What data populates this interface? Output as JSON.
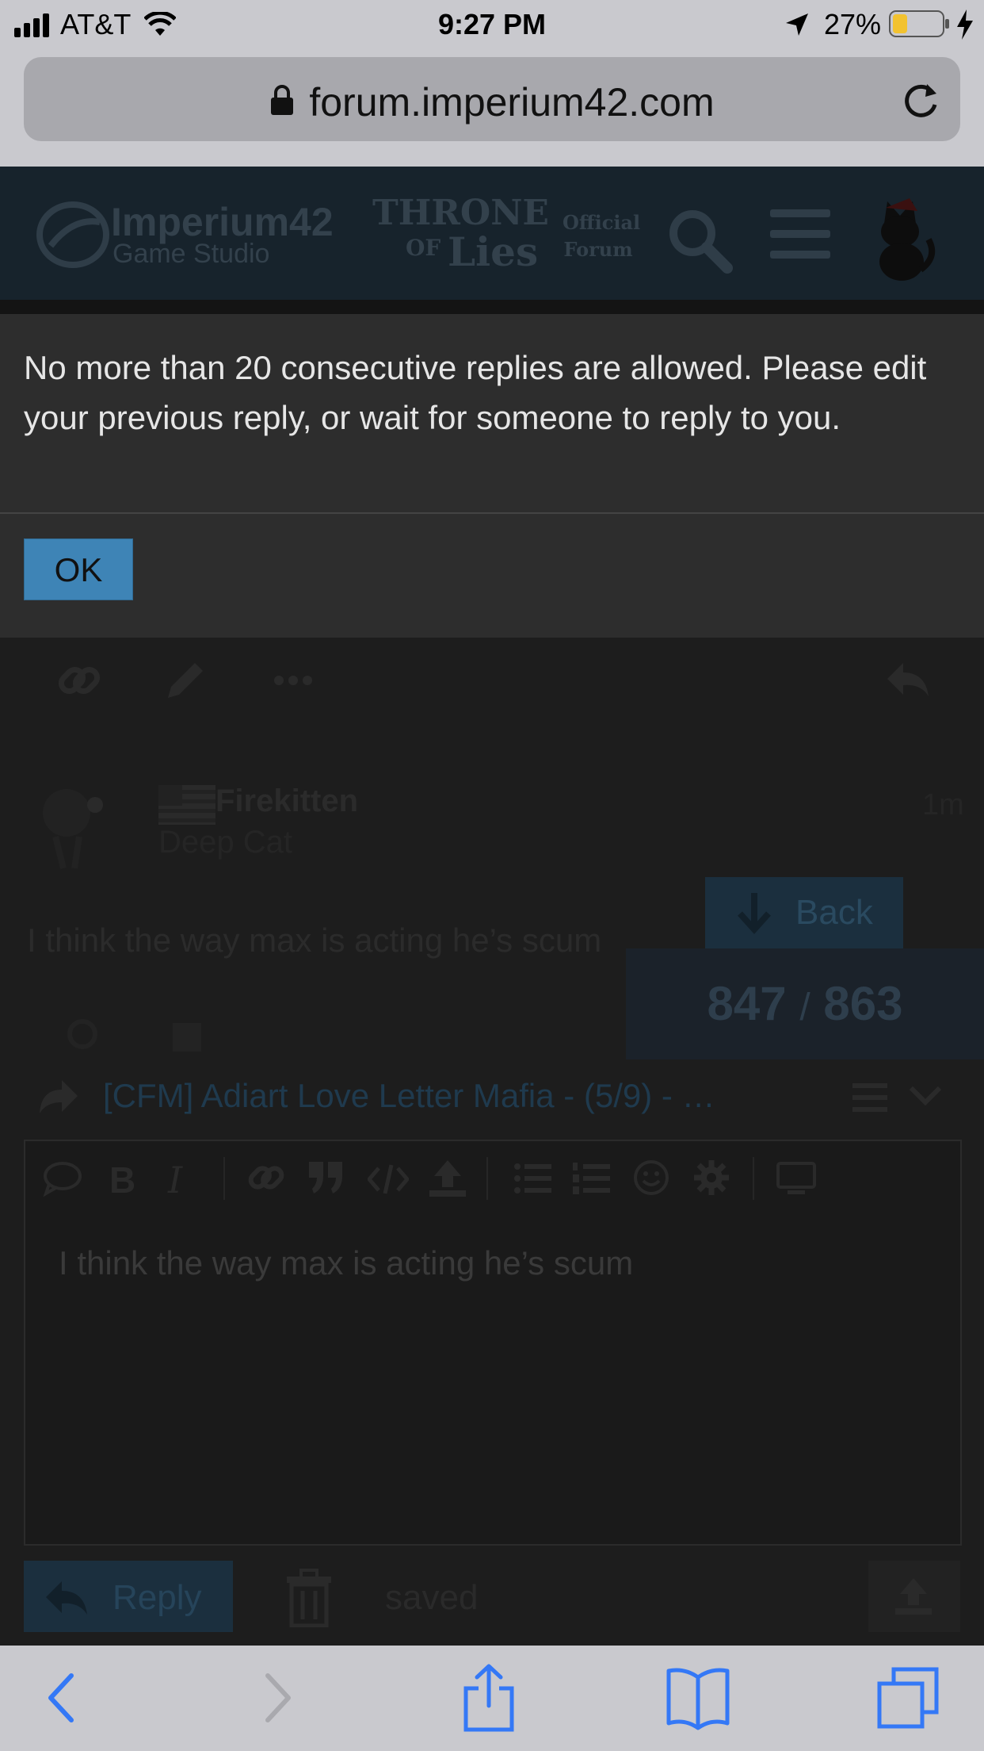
{
  "status_bar": {
    "carrier": "AT&T",
    "time": "9:27 PM",
    "battery": "27%",
    "icons": [
      "signal-icon",
      "wifi-icon",
      "location-icon",
      "battery-icon",
      "charging-icon"
    ]
  },
  "address_bar": {
    "url": "forum.imperium42.com",
    "lock_icon": "lock-icon",
    "reload_icon": "reload-icon"
  },
  "forum_header": {
    "logo_line1": "Imperium42",
    "logo_line2": "Game Studio",
    "game_logo_line1": "Throne",
    "game_logo_line2": "of",
    "game_logo_line3": "Lies",
    "official_line1": "Official",
    "official_line2": "Forum",
    "icons": [
      "search-icon",
      "menu-icon",
      "avatar-cat-icon"
    ]
  },
  "dialog": {
    "message": "No more than 20 consecutive replies are allowed. Please edit your previous reply, or wait for someone to reply to you.",
    "ok_label": "OK"
  },
  "post": {
    "actions": [
      "link-icon",
      "pencil-icon",
      "more-icon",
      "reply-icon"
    ],
    "author_name": "Firekitten",
    "author_title": "Deep Cat",
    "time_ago": "1m",
    "content": "I think the way max is acting he’s scum",
    "back_label": "Back",
    "counter_current": "847",
    "counter_sep": "/",
    "counter_total": "863"
  },
  "composer": {
    "topic_title": "[CFM] Adiart Love Letter Mafia - (5/9) - …",
    "toolbar_icons": [
      "quote-bubble-icon",
      "bold-icon",
      "italic-icon",
      "link-icon",
      "blockquote-icon",
      "code-icon",
      "upload-icon",
      "bullet-list-icon",
      "numbered-list-icon",
      "emoji-icon",
      "gear-icon",
      "preview-icon"
    ],
    "bold_glyph": "B",
    "italic_glyph": "I",
    "editor_text": "I think the way max is acting he’s scum",
    "reply_label": "Reply",
    "saved_label": "saved"
  },
  "safari_toolbar": {
    "icons": [
      "back-icon",
      "forward-icon",
      "share-icon",
      "bookmarks-icon",
      "tabs-icon"
    ]
  },
  "colors": {
    "dialog_bg": "#2d2d2d",
    "ok_button": "#3e84b6",
    "ios_bar": "#c9c9ce",
    "ios_blue": "#3478f6",
    "battery_fill": "#f2c230"
  }
}
